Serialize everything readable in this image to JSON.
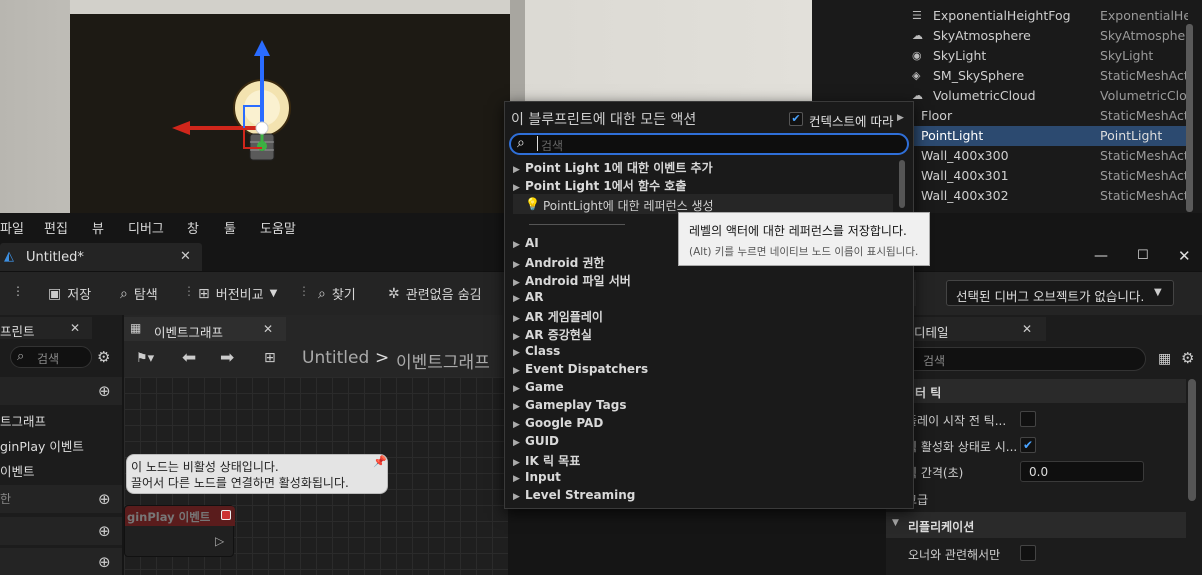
{
  "outliner": {
    "rows": [
      {
        "name": "ExponentialHeightFog",
        "type": "ExponentialHe",
        "icon": "fog-icon"
      },
      {
        "name": "SkyAtmosphere",
        "type": "SkyAtmospher",
        "icon": "sky-atmosphere-icon"
      },
      {
        "name": "SkyLight",
        "type": "SkyLight",
        "icon": "skylight-icon"
      },
      {
        "name": "SM_SkySphere",
        "type": "StaticMeshAct",
        "icon": "static-mesh-icon"
      },
      {
        "name": "VolumetricCloud",
        "type": "VolumetricClou",
        "icon": "cloud-icon"
      },
      {
        "name": "Floor",
        "type": "StaticMeshAct"
      },
      {
        "name": "PointLight",
        "type": "PointLight",
        "selected": true
      },
      {
        "name": "Wall_400x300",
        "type": "StaticMeshAct"
      },
      {
        "name": "Wall_400x301",
        "type": "StaticMeshAct"
      },
      {
        "name": "Wall_400x302",
        "type": "StaticMeshAct"
      }
    ]
  },
  "menubar": {
    "items": [
      "파일",
      "편집",
      "뷰",
      "디버그",
      "창",
      "툴",
      "도움말"
    ]
  },
  "tab": {
    "title": "Untitled*"
  },
  "toolbar": {
    "save": "저장",
    "browse": "탐색",
    "diff": "버전비교",
    "find": "찾기",
    "hide_unrelated": "관련없음 숨김",
    "debug_object": "선택된 디버그 오브젝트가 없습니다."
  },
  "left_panel": {
    "tab": "프린트",
    "search_placeholder": "검색",
    "items": [
      "트그래프",
      "ginPlay 이벤트",
      "이벤트",
      "한"
    ]
  },
  "graph": {
    "tab": "이벤트그래프",
    "breadcrumb_root": "Untitled",
    "breadcrumb_sep": ">",
    "breadcrumb_leaf": "이벤트그래프",
    "comment_line1": "이 노드는 비활성 상태입니다.",
    "comment_line2": "끌어서 다른 노드를 연결하면 활성화됩니다.",
    "node_title": "ginPlay 이벤트"
  },
  "popup": {
    "title": "이 블루프린트에 대한 모든 액션",
    "context_label": "컨텍스트에 따라",
    "search_placeholder": "검색",
    "top_items": [
      "Point Light 1에 대한 이벤트 추가",
      "Point Light 1에서 함수 호출"
    ],
    "ref_item": "PointLight에 대한 레퍼런스 생성",
    "categories": [
      "AI",
      "Android 권한",
      "Android 파일 서버",
      "AR",
      "AR 게임플레이",
      "AR 증강현실",
      "Class",
      "Event Dispatchers",
      "Game",
      "Gameplay Tags",
      "Google PAD",
      "GUID",
      "IK 릭 목표",
      "Input",
      "Level Streaming"
    ]
  },
  "tooltip": {
    "line1": "레벨의 액터에 대한 레퍼런스를 저장합니다.",
    "line2": "(Alt) 키를 누르면 네이티브 노드 이름이 표시됩니다."
  },
  "details": {
    "tab": "디테일",
    "search_placeholder": "검색",
    "section1": "액터 틱",
    "rows": [
      "플레이 시작 전 틱...",
      "틱 활성화 상태로 시...",
      "틱 간격(초)",
      "고급"
    ],
    "tick_interval": "0.0",
    "section2": "리플리케이션",
    "rep_row": "오너와 관련해서만"
  }
}
